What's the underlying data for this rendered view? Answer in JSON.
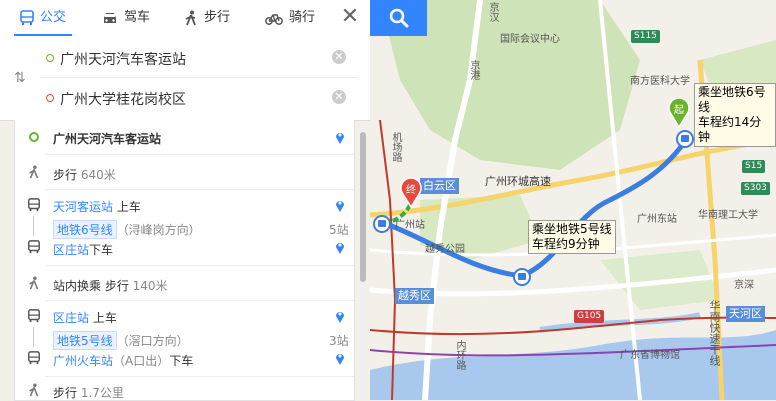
{
  "tabs": {
    "transit": "公交",
    "drive": "驾车",
    "walk": "步行",
    "bike": "骑行"
  },
  "inputs": {
    "origin": "广州天河汽车客运站",
    "destination": "广州大学桂花岗校区"
  },
  "steps": {
    "start": "广州天河汽车客运站",
    "walk1_label": "步行",
    "walk1_dist": "640米",
    "board1_station": "天河客运站",
    "board1_action": "上车",
    "line1_name": "地铁6号线",
    "line1_dir": "（浔峰岗方向）",
    "line1_stops": "5站",
    "alight1_station": "区庄站",
    "alight1_action": "下车",
    "transfer": "站内换乘 步行",
    "transfer_dist": "140米",
    "board2_station": "区庄站",
    "board2_action": "上车",
    "line2_name": "地铁5号线",
    "line2_dir": "（滘口方向）",
    "line2_stops": "3站",
    "alight2_station": "广州火车站",
    "alight2_exit": "（A口出）",
    "alight2_action": "下车",
    "walk2_label": "步行",
    "walk2_dist": "1.7公里"
  },
  "map": {
    "callout_start_1": "乘坐地铁6号线",
    "callout_start_2": "车程约14分钟",
    "callout_mid_1": "乘坐地铁5号线",
    "callout_mid_2": "车程约9分钟",
    "start_marker": "起",
    "end_marker": "终",
    "labels": {
      "intl_center": "国际会议中心",
      "nanfang": "南方医科大学",
      "huanan": "华南理工大学",
      "guangzhou_east": "广州东站",
      "guangzhou_station": "广州站",
      "yuexiu_park": "越秀公园",
      "museum": "广东省博物馆",
      "jichang": "机场路",
      "jingwang": "京港",
      "ring_road": "广州环城高速",
      "jingxi": "京汉",
      "huanan_expy": "华南快速干线",
      "jingyue": "京深",
      "neihuan": "内环路"
    },
    "districts": {
      "baiyun": "白云区",
      "yuexiu": "越秀区",
      "tianhe": "天河区"
    },
    "shields": {
      "s115": "S115",
      "s15": "S15",
      "s303": "S303",
      "g105": "G105"
    }
  },
  "colors": {
    "accent": "#3385ff",
    "route": "#3b7de0",
    "start_pin": "#6ab42d",
    "end_pin": "#e8493f"
  }
}
